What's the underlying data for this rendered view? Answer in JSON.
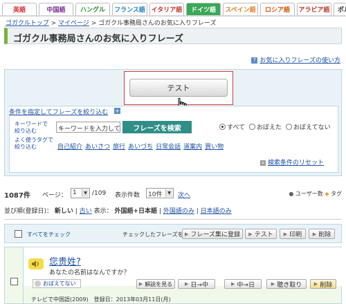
{
  "tabs": [
    {
      "label": "英語",
      "color": "#d9272e",
      "bg": "#ffffff"
    },
    {
      "label": "中国語",
      "color": "#7a2a8c",
      "bg": "#ffffff"
    },
    {
      "label": "ハングル",
      "color": "#2f8e2f",
      "bg": "#ffffff"
    },
    {
      "label": "フランス語",
      "color": "#1f7dbf",
      "bg": "#ffffff"
    },
    {
      "label": "イタリア語",
      "color": "#c0392b",
      "bg": "#ffffff"
    },
    {
      "label": "ドイツ語",
      "color": "#ffffff",
      "bg": "#3aa857"
    },
    {
      "label": "スペイン語",
      "color": "#e67e22",
      "bg": "#ffffff"
    },
    {
      "label": "ロシア語",
      "color": "#d35400",
      "bg": "#ffffff"
    },
    {
      "label": "アラビア語",
      "color": "#c0392b",
      "bg": "#ffffff"
    },
    {
      "label": "ポル",
      "color": "#333333",
      "bg": "#ffffff"
    }
  ],
  "breadcrumb": {
    "home": "ゴガクルトップ",
    "sep": ">",
    "mypage": "マイページ",
    "current": "ゴガクル事務局さんのお気に入りフレーズ"
  },
  "page_title": "ゴガクル事務局さんのお気に入りフレーズ",
  "usage_link": "お気に入りフレーズの使い方",
  "test_button": "テスト",
  "filter": {
    "condition_label": "条件を指定してフレーズを絞り込む",
    "keyword_label": "キーワードで\n絞り込む",
    "keyword_placeholder": "キーワードを入力して",
    "search_button": "フレーズを検索",
    "radios": [
      {
        "label": "すべて",
        "checked": true
      },
      {
        "label": "おぼえた",
        "checked": false
      },
      {
        "label": "おぼえてない",
        "checked": false
      }
    ],
    "tag_label": "よく使うタグで\n絞り込む",
    "tags": [
      "自己紹介",
      "あいさつ",
      "旅行",
      "あいづち",
      "日常会話",
      "道案内",
      "買い物"
    ],
    "reset": "検索条件のリセット"
  },
  "pager": {
    "count": "1087件",
    "page_label": "ページ：",
    "page_value": "1",
    "page_total": "/109",
    "per_page_label": "表示件数",
    "per_page_value": "10件",
    "next": "次へ",
    "legend_user": "ユーザー数",
    "legend_tag": "タグ"
  },
  "sort": {
    "label": "並び順(登録日)：",
    "newest": "新しい",
    "divider": "|",
    "oldest": "古い",
    "display_label": "表示：",
    "display_both": "外国語+日本語",
    "display_foreign": "外国語のみ",
    "display_japanese": "日本語のみ"
  },
  "actions": {
    "check_all": "すべてをチェック",
    "checked_label": "チェックしたフレーズを",
    "register": "フレーズ集に登録",
    "test": "テスト",
    "print": "印刷",
    "delete": "削除"
  },
  "entry": {
    "chinese": "您贵姓?",
    "japanese": "あなたの名前はなんですか？",
    "remember": "おぼえてない",
    "explain": "解説を見る",
    "jp_to_cn": "日→中",
    "cn_to_jp": "中→日",
    "listen": "聴き取り",
    "delete": "削除",
    "source": "テレビで中国語(2009)　登録日：2013年03月11日(月)"
  }
}
